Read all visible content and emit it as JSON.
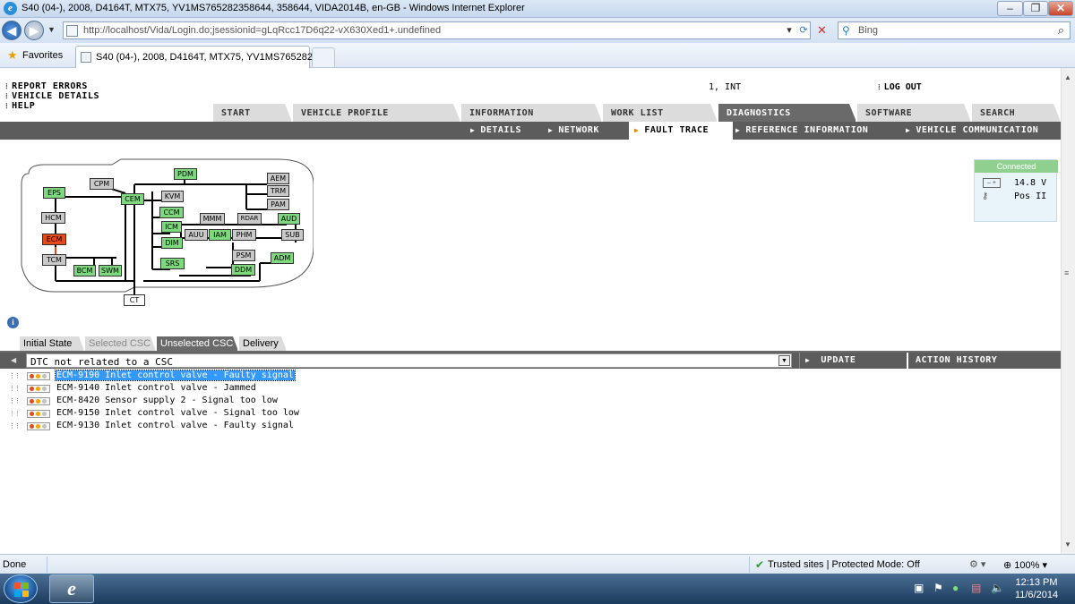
{
  "window": {
    "title": "S40 (04-), 2008, D4164T, MTX75, YV1MS765282358644, 358644, VIDA2014B, en-GB - Windows Internet Explorer",
    "minimize": "–",
    "maximize": "❐",
    "close": "✕"
  },
  "browser": {
    "url": "http://localhost/Vida/Login.do;jsessionid=gLqRcc17D6q22-vX630Xed1+.undefined",
    "search_placeholder": "Bing",
    "favorites_label": "Favorites",
    "tab_title": "S40 (04-), 2008, D4164T, MTX75, YV1MS76528235...",
    "status_text": "Done",
    "zone_text": "Trusted sites | Protected Mode: Off",
    "zoom": "100%"
  },
  "header": {
    "links": [
      "REPORT ERRORS",
      "VEHICLE DETAILS",
      "HELP"
    ],
    "user": "1, INT",
    "logout": "LOG OUT"
  },
  "main_tabs": [
    "START",
    "VEHICLE PROFILE",
    "INFORMATION",
    "WORK LIST",
    "DIAGNOSTICS",
    "SOFTWARE",
    "SEARCH"
  ],
  "active_main_tab": "DIAGNOSTICS",
  "sub_tabs": [
    "DETAILS",
    "NETWORK",
    "FAULT TRACE",
    "REFERENCE INFORMATION",
    "VEHICLE COMMUNICATION"
  ],
  "active_sub_tab": "FAULT TRACE",
  "connection": {
    "status": "Connected",
    "voltage": "14.8 V",
    "ignition": "Pos II",
    "status_color": "#8fd08f"
  },
  "network_nodes": {
    "pdm": "PDM",
    "cpm": "CPM",
    "cem": "CEM",
    "kvm": "KVM",
    "aem": "AEM",
    "trm": "TRM",
    "pam": "PAM",
    "eps": "EPS",
    "hcm": "HCM",
    "ecm": "ECM",
    "tcm": "TCM",
    "ccm": "CCM",
    "mmm": "MMM",
    "rdar": "RDAR",
    "aud": "AUD",
    "icm": "ICM",
    "auu": "AUU",
    "iam": "IAM",
    "phm": "PHM",
    "sub": "SUB",
    "dim": "DIM",
    "psm": "PSM",
    "srs": "SRS",
    "adm": "ADM",
    "ddm": "DDM",
    "bcm": "BCM",
    "swm": "SWM",
    "ct": "CT"
  },
  "csc_tabs": [
    "Initial State",
    "Selected CSC",
    "Unselected CSC",
    "Delivery"
  ],
  "active_csc_tab": "Unselected CSC",
  "csc_select": {
    "value": "DTC not related to a CSC"
  },
  "actions": {
    "update": "UPDATE",
    "history": "ACTION HISTORY"
  },
  "dtcs": [
    "ECM-9190 Inlet control valve - Faulty signal",
    "ECM-9140 Inlet control valve - Jammed",
    "ECM-8420 Sensor supply 2 - Signal too low",
    "ECM-9150 Inlet control valve - Signal too low",
    "ECM-9130 Inlet control valve - Faulty signal"
  ],
  "selected_dtc": "ECM-9190 Inlet control valve - Faulty signal",
  "clock": {
    "time": "12:13 PM",
    "date": "11/6/2014"
  }
}
